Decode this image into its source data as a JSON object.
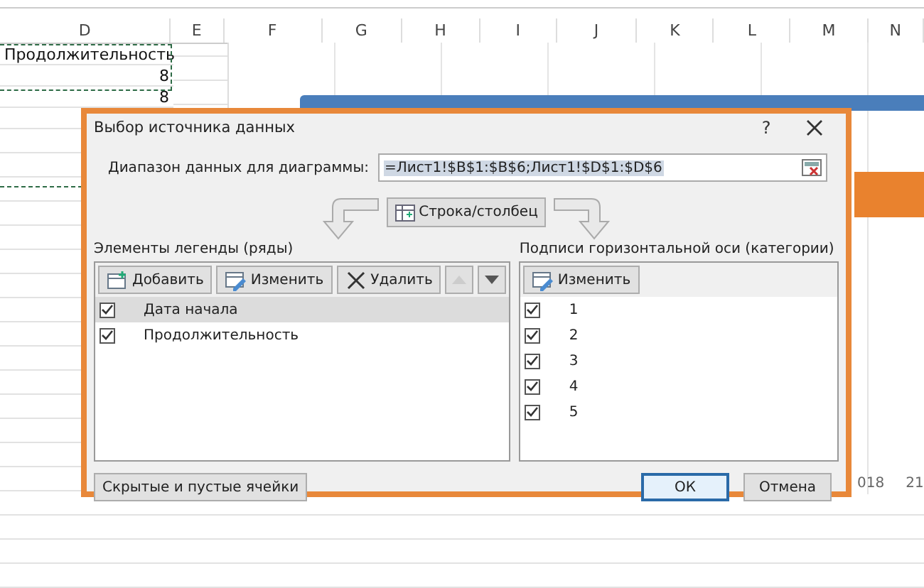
{
  "sheet": {
    "column_headers": [
      "D",
      "E",
      "F",
      "G",
      "H",
      "I",
      "J",
      "K",
      "L",
      "M",
      "N"
    ],
    "cells": [
      {
        "text": "Продолжительность",
        "kind": "text"
      },
      {
        "text": "8",
        "kind": "number"
      },
      {
        "text": "8",
        "kind": "number"
      }
    ]
  },
  "chart": {
    "axis_labels": [
      "018",
      "21"
    ]
  },
  "dialog": {
    "title": "Выбор источника данных",
    "help": "?",
    "range_label": "Диапазон данных для диаграммы:",
    "range_value": "=Лист1!$B$1:$B$6;Лист1!$D$1:$D$6",
    "switch_button": "Строка/столбец",
    "legend": {
      "title": "Элементы легенды (ряды)",
      "buttons": [
        {
          "kind": "add",
          "label": "Добавить"
        },
        {
          "kind": "edit",
          "label": "Изменить"
        },
        {
          "kind": "delete",
          "label": "Удалить"
        },
        {
          "kind": "up",
          "disabled": true
        },
        {
          "kind": "down",
          "disabled": false
        }
      ],
      "series": [
        {
          "label": "Дата начала",
          "checked": true,
          "selected": true
        },
        {
          "label": "Продолжительность",
          "checked": true,
          "selected": false
        }
      ]
    },
    "axis": {
      "title": "Подписи горизонтальной оси (категории)",
      "edit_button": "Изменить",
      "categories": [
        {
          "label": "1",
          "checked": true
        },
        {
          "label": "2",
          "checked": true
        },
        {
          "label": "3",
          "checked": true
        },
        {
          "label": "4",
          "checked": true
        },
        {
          "label": "5",
          "checked": true
        }
      ]
    },
    "hidden_cells_button": "Скрытые и пустые ячейки",
    "ok_button": "ОК",
    "cancel_button": "Отмена"
  }
}
